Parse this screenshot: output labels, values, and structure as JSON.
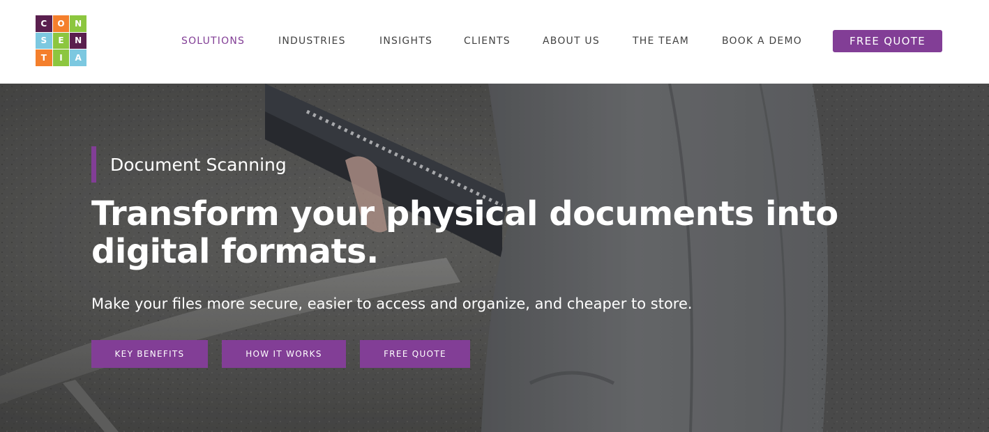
{
  "brand": {
    "logo_letters": [
      "C",
      "O",
      "N",
      "S",
      "E",
      "N",
      "T",
      "I",
      "A"
    ],
    "logo_colors": [
      "#5a1f4e",
      "#f47f2c",
      "#8cc63f",
      "#7cc8e0",
      "#8cc63f",
      "#5a1f4e",
      "#f47f2c",
      "#8cc63f",
      "#7cc8e0"
    ],
    "accent_color": "#823e96"
  },
  "nav": {
    "items": [
      {
        "label": "SOLUTIONS",
        "active": true
      },
      {
        "label": "INDUSTRIES",
        "active": false
      },
      {
        "label": "INSIGHTS",
        "active": false
      },
      {
        "label": "CLIENTS",
        "active": false
      },
      {
        "label": "ABOUT US",
        "active": false
      },
      {
        "label": "THE TEAM",
        "active": false
      },
      {
        "label": "BOOK A DEMO",
        "active": false
      }
    ],
    "quote_label": "FREE QUOTE"
  },
  "hero": {
    "eyebrow": "Document Scanning",
    "headline": "Transform your physical documents into digital formats.",
    "subline": "Make your files more secure, easier to access and organize, and cheaper to store.",
    "buttons": [
      {
        "label": "KEY BENEFITS"
      },
      {
        "label": "HOW IT WORKS"
      },
      {
        "label": "FREE QUOTE"
      }
    ]
  }
}
